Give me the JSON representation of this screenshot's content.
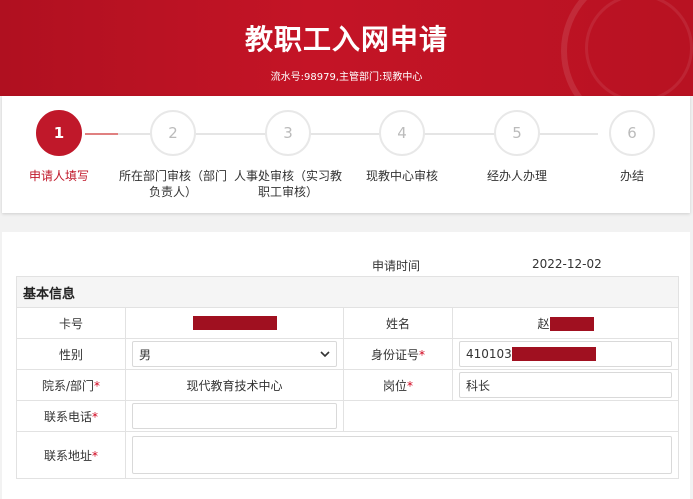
{
  "header": {
    "title": "教职工入网申请",
    "subtitle": "流水号:98979,主管部门:现教中心"
  },
  "steps": [
    {
      "num": "1",
      "label": "申请人填写",
      "active": true
    },
    {
      "num": "2",
      "label": "所在部门审核（部门负责人）",
      "active": false
    },
    {
      "num": "3",
      "label": "人事处审核（实习教职工审核）",
      "active": false
    },
    {
      "num": "4",
      "label": "现教中心审核",
      "active": false
    },
    {
      "num": "5",
      "label": "经办人办理",
      "active": false
    },
    {
      "num": "6",
      "label": "办结",
      "active": false
    }
  ],
  "form": {
    "time_label": "申请时间",
    "time_value": "2022-12-02",
    "section_title": "基本信息",
    "card_label": "卡号",
    "name_label": "姓名",
    "name_value": "赵",
    "gender_label": "性别",
    "gender_value": "男",
    "id_label": "身份证号",
    "id_value": "410103",
    "dept_label": "院系/部门",
    "dept_value": "现代教育技术中心",
    "position_label": "岗位",
    "position_value": "科长",
    "phone_label": "联系电话",
    "phone_value": "",
    "address_label": "联系地址",
    "address_value": "",
    "required_mark": "*",
    "redact_color": "#a01020"
  }
}
